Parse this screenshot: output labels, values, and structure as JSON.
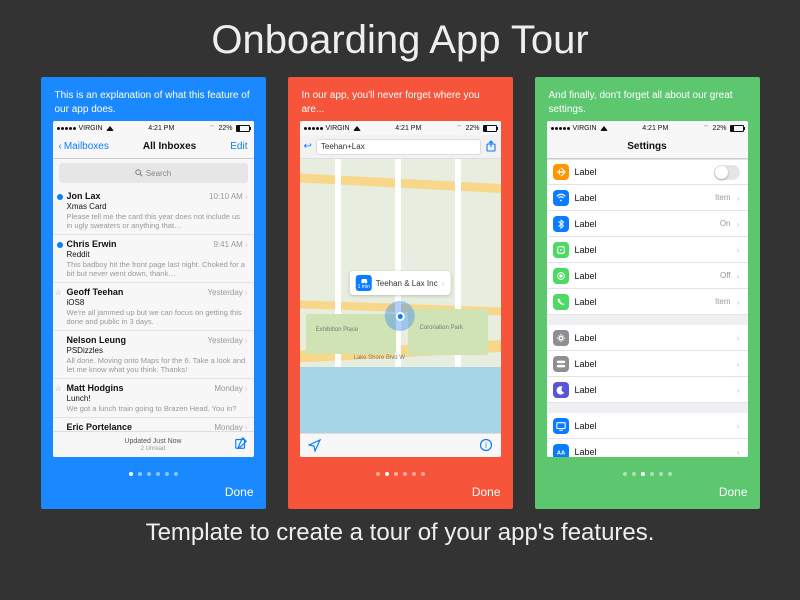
{
  "page": {
    "title": "Onboarding App Tour",
    "subtitle": "Template to create a tour of your app's features."
  },
  "common": {
    "carrier": "VIRGIN",
    "time": "4:21 PM",
    "battery": "22%",
    "done": "Done"
  },
  "card1": {
    "caption": "This is an explanation of what this feature of our app does.",
    "nav_back": "Mailboxes",
    "nav_title": "All Inboxes",
    "nav_right": "Edit",
    "search_placeholder": "Search",
    "footer_status": "Updated Just Now",
    "footer_unread": "2 Unread",
    "rows": [
      {
        "name": "Jon Lax",
        "time": "10:10 AM",
        "subject": "Xmas Card",
        "preview": "Please tell me the card this year does not include us in ugly sweaters or anything that…",
        "unread": true,
        "star": false
      },
      {
        "name": "Chris Erwin",
        "time": "9:41 AM",
        "subject": "Reddit",
        "preview": "This badboy hit the front page last night. Choked for a bit but never went down, thank…",
        "unread": true,
        "star": false
      },
      {
        "name": "Geoff Teehan",
        "time": "Yesterday",
        "subject": "iOS8",
        "preview": "We're all jammed up but we can focus on getting this done and public in 3 days.",
        "unread": false,
        "star": true
      },
      {
        "name": "Nelson Leung",
        "time": "Yesterday",
        "subject": "PSDizzles",
        "preview": "All done. Moving onto Maps for the 6. Take a look and let me know what you think. Thanks!",
        "unread": false,
        "star": false
      },
      {
        "name": "Matt Hodgins",
        "time": "Monday",
        "subject": "Lunch!",
        "preview": "We got a lunch train going to Brazen Head. You in?",
        "unread": false,
        "star": true
      },
      {
        "name": "Eric Portelance",
        "time": "Monday",
        "subject": "",
        "preview": "",
        "unread": false,
        "star": false
      }
    ],
    "pager_active": 0,
    "pager_count": 6
  },
  "card2": {
    "caption": "In our app, you'll never forget where you are...",
    "search_value": "Teehan+Lax",
    "callout": "Teehan & Lax Inc",
    "callout_sub": "1 min",
    "labels": {
      "exhibition": "Exhibition Place",
      "coronation": "Coronation Park",
      "lakeshore": "Lake Shore Blvd W"
    },
    "pager_active": 1,
    "pager_count": 6
  },
  "card3": {
    "caption": "And finally, don't forget all about our great settings.",
    "nav_title": "Settings",
    "groups": [
      [
        {
          "icon": "plane",
          "color": "#ff9500",
          "label": "Label",
          "value": "",
          "toggle": true
        },
        {
          "icon": "wifi",
          "color": "#0a7cff",
          "label": "Label",
          "value": "Item"
        },
        {
          "icon": "bluetooth",
          "color": "#0a7cff",
          "label": "Label",
          "value": "On"
        },
        {
          "icon": "cell",
          "color": "#4cd964",
          "label": "Label",
          "value": ""
        },
        {
          "icon": "hotspot",
          "color": "#4cd964",
          "label": "Label",
          "value": "Off"
        },
        {
          "icon": "phone",
          "color": "#4cd964",
          "label": "Label",
          "value": "Item"
        }
      ],
      [
        {
          "icon": "gear",
          "color": "#8e8e93",
          "label": "Label",
          "value": ""
        },
        {
          "icon": "switches",
          "color": "#8e8e93",
          "label": "Label",
          "value": ""
        },
        {
          "icon": "moon",
          "color": "#5856d6",
          "label": "Label",
          "value": ""
        }
      ],
      [
        {
          "icon": "display",
          "color": "#0a7cff",
          "label": "Label",
          "value": ""
        },
        {
          "icon": "text",
          "color": "#0a7cff",
          "label": "Label",
          "value": ""
        }
      ]
    ],
    "pager_active": 2,
    "pager_count": 6
  }
}
